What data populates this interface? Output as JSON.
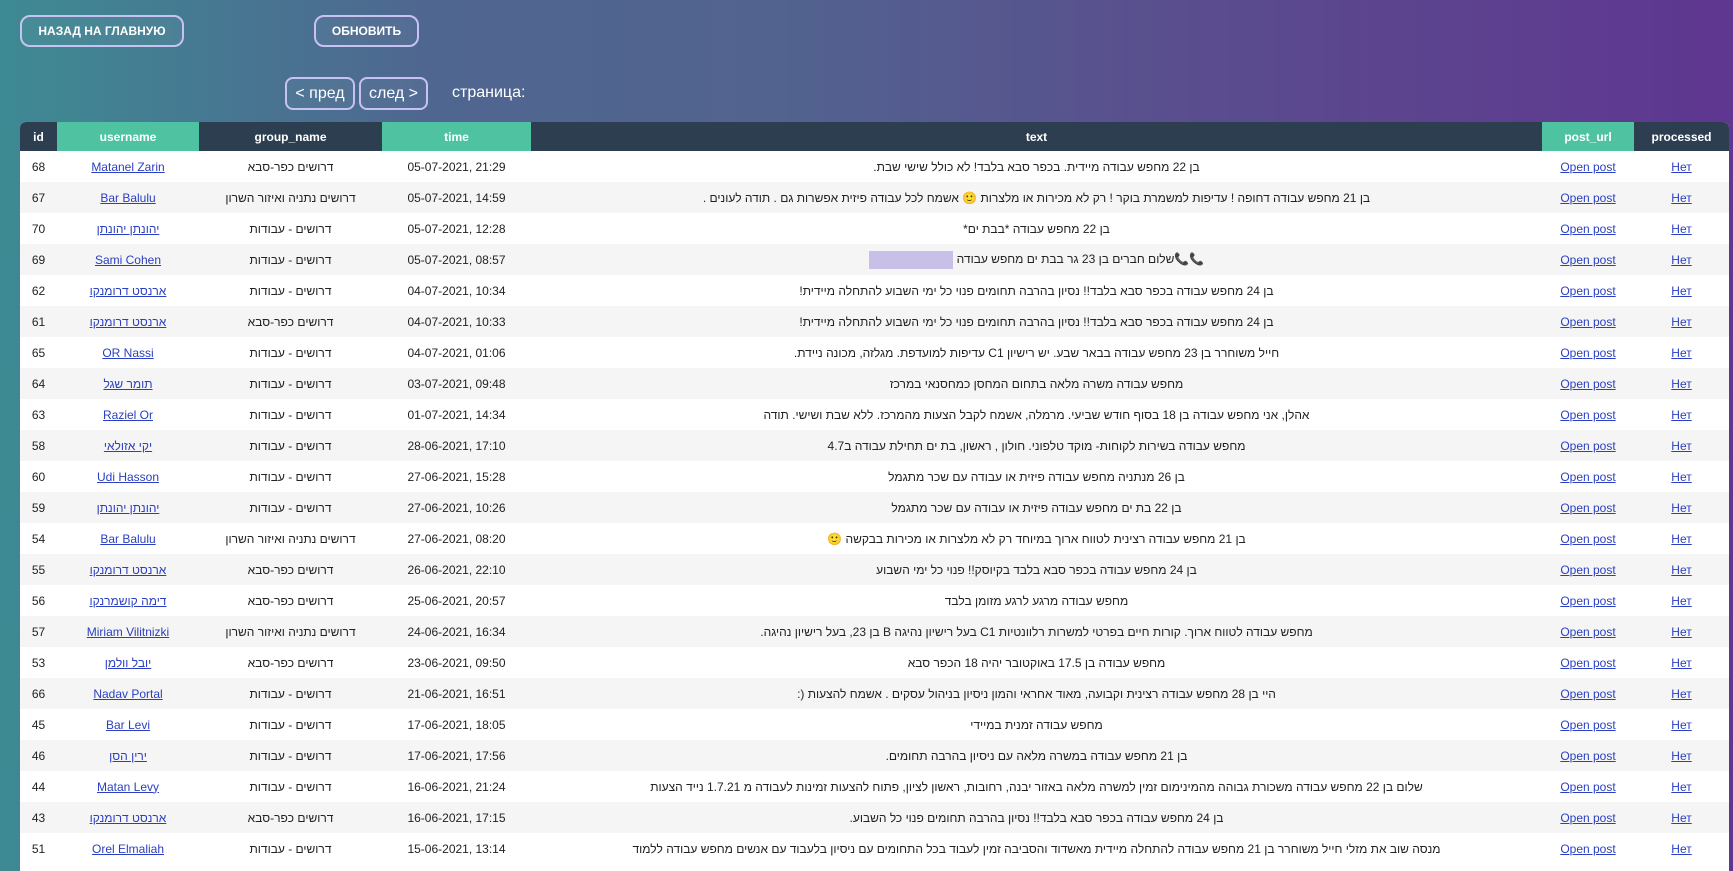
{
  "top": {
    "home_label": "НАЗАД НА ГЛАВНУЮ",
    "refresh_label": "ОБНОВИТЬ"
  },
  "pager": {
    "prev_label": "< пред",
    "next_label": "след >",
    "page_label": "страница:"
  },
  "colors": {
    "header_dark": "#2c3e50",
    "header_green": "#4fc3a1",
    "link": "#2a3fc1",
    "button_border": "#c7c2f2"
  },
  "table": {
    "columns": [
      "id",
      "username",
      "group_name",
      "time",
      "text",
      "post_url",
      "processed"
    ],
    "rows": [
      {
        "id": "68",
        "username": "Matanel Zarin",
        "group": "דרושים כפר-סבא",
        "time": "05-07-2021, 21:29",
        "text": "בן 22 מחפש עבודה מיידית. בכפר סבא בלבד! לא כולל שישי שבת.",
        "url": "Open post",
        "processed": "Нет"
      },
      {
        "id": "67",
        "username": "Bar Balulu",
        "group": "דרושים נתניה ואיזור השרון",
        "time": "05-07-2021, 14:59",
        "text": "בן 21 מחפש עבודה דחופה ! עדיפות למשמרת בוקר ! רק לא מכירות או מלצרות 🙂 אשמח לכל עבודה פיזית אפשרות גם . תודה לעונים .",
        "url": "Open post",
        "processed": "Нет"
      },
      {
        "id": "70",
        "username": "יהונתן יהונתן",
        "group": "דרושים - עבודות",
        "time": "05-07-2021, 12:28",
        "text": "בן 22 מחפש עבודה *בבת ים*",
        "url": "Open post",
        "processed": "Нет"
      },
      {
        "id": "69",
        "username": "Sami Cohen",
        "group": "דרושים - עבודות",
        "time": "05-07-2021, 08:57",
        "text": "📞📞שלום חברים בן 23 גר בבת ים מחפש עבודה",
        "url": "Open post",
        "processed": "Нет"
      },
      {
        "id": "62",
        "username": "ארנסט דרומנקו",
        "group": "דרושים - עבודות",
        "time": "04-07-2021, 10:34",
        "text": "בן 24 מחפש עבודה בכפר סבא בלבד!! נסיון בהרבה תחומים פנוי כל ימי השבוע להתחלה מיידית!",
        "url": "Open post",
        "processed": "Нет"
      },
      {
        "id": "61",
        "username": "ארנסט דרומנקו",
        "group": "דרושים כפר-סבא",
        "time": "04-07-2021, 10:33",
        "text": "בן 24 מחפש עבודה בכפר סבא בלבד!! נסיון בהרבה תחומים פנוי כל ימי השבוע להתחלה מיידית!",
        "url": "Open post",
        "processed": "Нет"
      },
      {
        "id": "65",
        "username": "OR Nassi",
        "group": "דרושים - עבודות",
        "time": "04-07-2021, 01:06",
        "text": "חייל משוחרר בן 23 מחפש עבודה בבאר שבע. יש רישיון C1 עדיפות למועדפת. מגלזה, מכונה ניידת.",
        "url": "Open post",
        "processed": "Нет"
      },
      {
        "id": "64",
        "username": "תומר שגל",
        "group": "דרושים - עבודות",
        "time": "03-07-2021, 09:48",
        "text": "מחפש עבודה משרה מלאה בתחום המחסן כמחסנאי במרכז",
        "url": "Open post",
        "processed": "Нет"
      },
      {
        "id": "63",
        "username": "Raziel Or",
        "group": "דרושים - עבודות",
        "time": "01-07-2021, 14:34",
        "text": "אהלן, אני מחפש עבודה בן 18 בסוף חודש שביעי. מרמלה, אשמח לקבל הצעות מהמרכז. ללא שבת ושישי. תודה",
        "url": "Open post",
        "processed": "Нет"
      },
      {
        "id": "58",
        "username": "יקי אזולאי",
        "group": "דרושים - עבודות",
        "time": "28-06-2021, 17:10",
        "text": "מחפש עבודה בשירות לקוחות- מוקד טלפוני. חולון , ראשון, בת ים תחילת עבודה ב4.7",
        "url": "Open post",
        "processed": "Нет"
      },
      {
        "id": "60",
        "username": "Udi Hasson",
        "group": "דרושים - עבודות",
        "time": "27-06-2021, 15:28",
        "text": "בן 26 מנתניה מחפש עבודה פיזית או עבודה עם שכר מתגמל",
        "url": "Open post",
        "processed": "Нет"
      },
      {
        "id": "59",
        "username": "יהונתן יהונתן",
        "group": "דרושים - עבודות",
        "time": "27-06-2021, 10:26",
        "text": "בן 22 בת ים מחפש עבודה פיזית או עבודה עם שכר מתגמל",
        "url": "Open post",
        "processed": "Нет"
      },
      {
        "id": "54",
        "username": "Bar Balulu",
        "group": "דרושים נתניה ואיזור השרון",
        "time": "27-06-2021, 08:20",
        "text": "בן 21 מחפש עבודה רצינית לטווח ארוך במיוחד רק לא מלצרות או מכירות בבקשה 🙂",
        "url": "Open post",
        "processed": "Нет"
      },
      {
        "id": "55",
        "username": "ארנסט דרומנקו",
        "group": "דרושים כפר-סבא",
        "time": "26-06-2021, 22:10",
        "text": "בן 24 מחפש עבודה בכפר סבא בלבד בקיוסק!! פנוי כל ימי השבוע",
        "url": "Open post",
        "processed": "Нет"
      },
      {
        "id": "56",
        "username": "דימה קושמרנקו",
        "group": "דרושים כפר-סבא",
        "time": "25-06-2021, 20:57",
        "text": "מחפש עבודה מרגע לרגע מזומן בלבד",
        "url": "Open post",
        "processed": "Нет"
      },
      {
        "id": "57",
        "username": "Miriam Vilitnizki",
        "group": "דרושים נתניה ואיזור השרון",
        "time": "24-06-2021, 16:34",
        "text": "מחפש עבודה לטווח ארוך. קורות חיים בפרטי למשרות רלוונטיות C1 בעל רישיון נהיגה B בן 23, בעל רישיון נהיגה.",
        "url": "Open post",
        "processed": "Нет"
      },
      {
        "id": "53",
        "username": "יובל וולמן",
        "group": "דרושים כפר-סבא",
        "time": "23-06-2021, 09:50",
        "text": "מחפש עבודה בן 17.5 באוקטובר יהיה 18 הכפר סבא",
        "url": "Open post",
        "processed": "Нет"
      },
      {
        "id": "66",
        "username": "Nadav Portal",
        "group": "דרושים - עבודות",
        "time": "21-06-2021, 16:51",
        "text": "היי בן 28 מחפש עבודה רצינית וקבועה, מאוד אחראי והמון ניסיון בניהול עסקים . אשמח להצעות (:",
        "url": "Open post",
        "processed": "Нет"
      },
      {
        "id": "45",
        "username": "Bar Levi",
        "group": "דרושים - עבודות",
        "time": "17-06-2021, 18:05",
        "text": "מחפש עבודה זמנית במיידי",
        "url": "Open post",
        "processed": "Нет"
      },
      {
        "id": "46",
        "username": "ירין הסן",
        "group": "דרושים - עבודות",
        "time": "17-06-2021, 17:56",
        "text": "בן 21 מחפש עבודה במשרה מלאה עם ניסיון בהרבה תחומים.",
        "url": "Open post",
        "processed": "Нет"
      },
      {
        "id": "44",
        "username": "Matan Levy",
        "group": "דרושים - עבודות",
        "time": "16-06-2021, 21:24",
        "text": "שלום בן 22 מחפש עבודה משכורת גבוהה מהמינימום זמין למשרה מלאה באזור יבנה, רחובות, ראשון לציון, פתוח להצעות זמינות לעבודה מ 1.7.21 נייד הצעות",
        "url": "Open post",
        "processed": "Нет"
      },
      {
        "id": "43",
        "username": "ארנסט דרומנקו",
        "group": "דרושים כפר-סבא",
        "time": "16-06-2021, 17:15",
        "text": "בן 24 מחפש עבודה בכפר סבא בלבד!! נסיון בהרבה תחומים פנוי כל השבוע.",
        "url": "Open post",
        "processed": "Нет"
      },
      {
        "id": "51",
        "username": "Orel Elmaliah",
        "group": "דרושים - עבודות",
        "time": "15-06-2021, 13:14",
        "text": "מנסה שוב את מזלי חייל משוחרר בן 21 מחפש עבודה להתחלה מיידית מאשדוד והסביבה זמין לעבוד בכל התחומים עם ניסיון בלעבוד עם אנשים מחפש עבודה ללמוד",
        "url": "Open post",
        "processed": "Нет"
      }
    ]
  }
}
